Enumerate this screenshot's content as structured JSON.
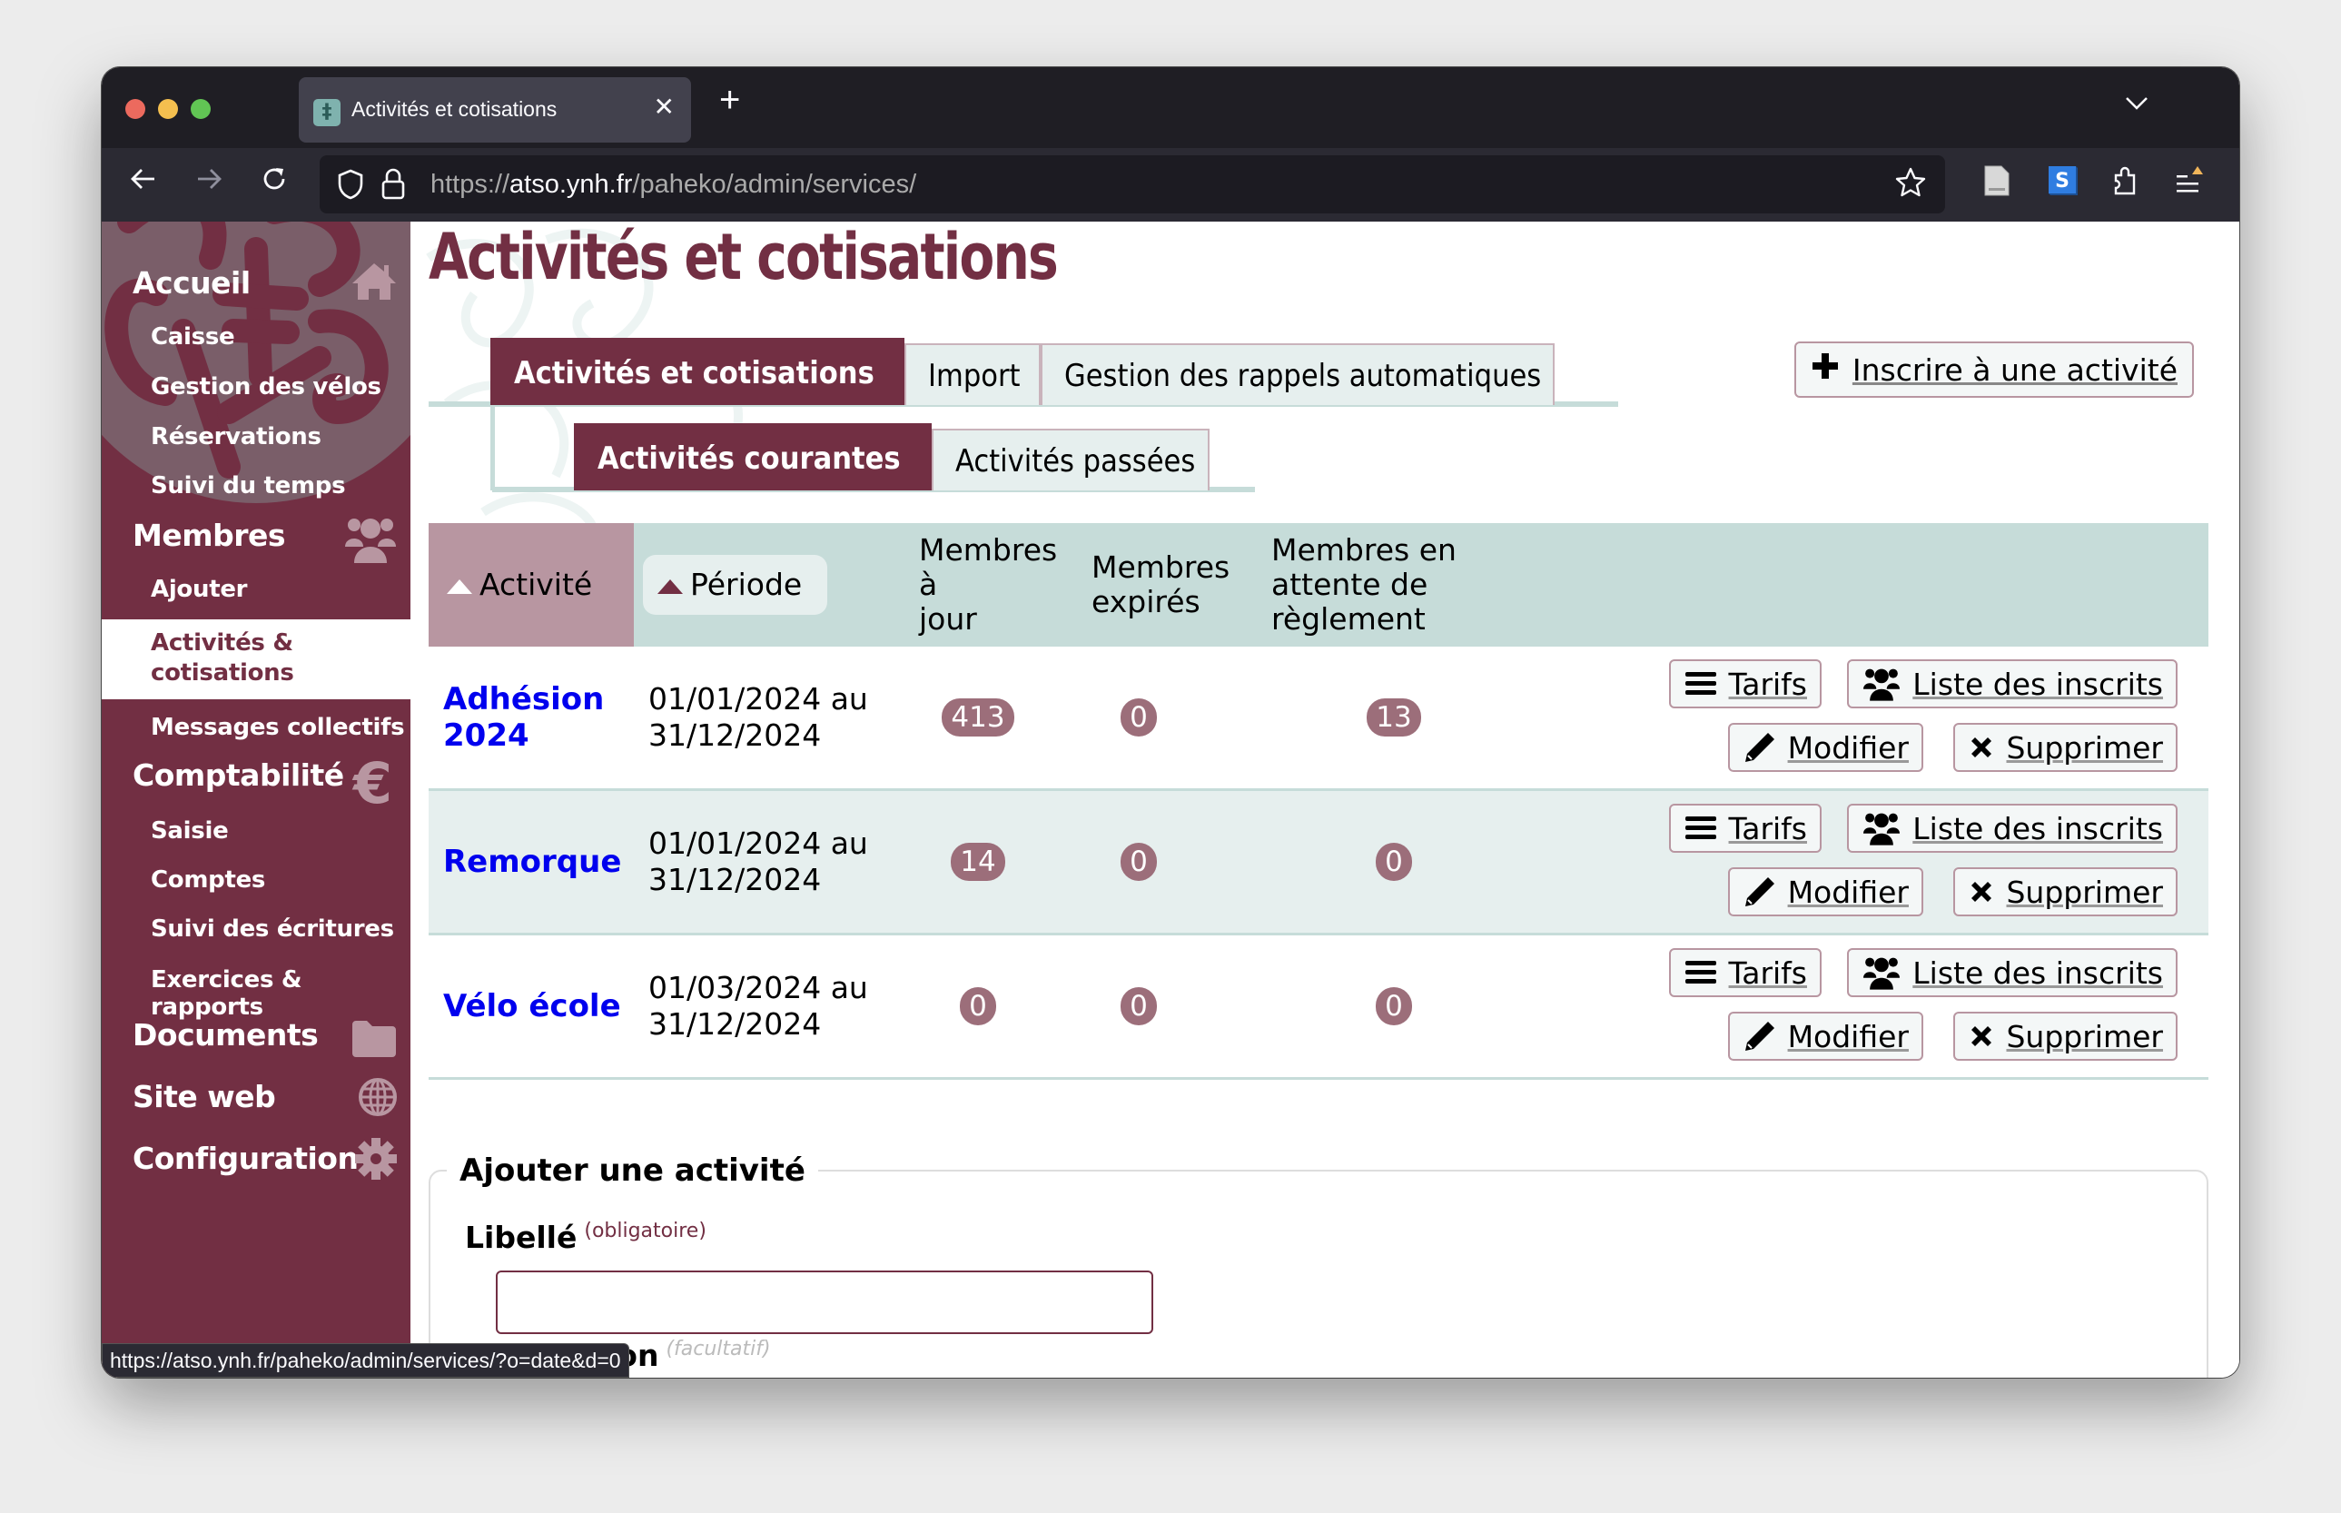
{
  "browser": {
    "tab_title": "Activités et cotisations",
    "url_prefix": "https://",
    "url_host": "atso.ynh.fr",
    "url_path": "/paheko/admin/services/",
    "status_url": "https://atso.ynh.fr/paheko/admin/services/?o=date&d=0",
    "icons": [
      "back-icon",
      "forward-icon",
      "reload-icon",
      "shield-icon",
      "lock-icon",
      "star-icon",
      "reader-icon",
      "extension-s-icon",
      "extensions-icon",
      "menu-icon"
    ]
  },
  "sidebar": {
    "sections": [
      {
        "label": "Accueil",
        "icon": "home-icon",
        "items": [
          "Caisse",
          "Gestion des vélos",
          "Réservations",
          "Suivi du temps"
        ]
      },
      {
        "label": "Membres",
        "icon": "users-icon",
        "items": [
          "Ajouter",
          "Activités & cotisations",
          "Messages collectifs"
        ]
      },
      {
        "label": "Comptabilité",
        "icon": "euro-icon",
        "items": [
          "Saisie",
          "Comptes",
          "Suivi des écritures",
          "Exercices & rapports"
        ]
      },
      {
        "label": "Documents",
        "icon": "folder-icon",
        "items": []
      },
      {
        "label": "Site web",
        "icon": "globe-icon",
        "items": []
      },
      {
        "label": "Configuration",
        "icon": "gear-icon",
        "items": []
      }
    ],
    "active_item": "Activités & cotisations",
    "active_item_line1": "Activités &",
    "active_item_line2": "cotisations"
  },
  "page": {
    "title": "Activités et cotisations",
    "tabs": [
      {
        "label": "Activités et cotisations",
        "active": true
      },
      {
        "label": "Import",
        "active": false
      },
      {
        "label": "Gestion des rappels automatiques",
        "active": false
      }
    ],
    "subtabs": [
      {
        "label": "Activités courantes",
        "active": true
      },
      {
        "label": "Activités passées",
        "active": false
      }
    ],
    "add_button": "Inscrire à une activité"
  },
  "table": {
    "headers": {
      "activity": "Activité",
      "period": "Période",
      "up_to_date_1": "Membres à",
      "up_to_date_2": "jour",
      "expired_1": "Membres",
      "expired_2": "expirés",
      "pending_1": "Membres en",
      "pending_2": "attente de",
      "pending_3": "règlement"
    },
    "rows": [
      {
        "name_1": "Adhésion",
        "name_2": "2024",
        "period_1": "01/01/2024 au",
        "period_2": "31/12/2024",
        "up_to_date": "413",
        "expired": "0",
        "pending": "13"
      },
      {
        "name_1": "Remorque",
        "name_2": "",
        "period_1": "01/01/2024 au",
        "period_2": "31/12/2024",
        "up_to_date": "14",
        "expired": "0",
        "pending": "0"
      },
      {
        "name_1": "Vélo école",
        "name_2": "",
        "period_1": "01/03/2024 au",
        "period_2": "31/12/2024",
        "up_to_date": "0",
        "expired": "0",
        "pending": "0"
      }
    ],
    "row_actions": {
      "tarifs": "Tarifs",
      "inscrits": "Liste des inscrits",
      "modifier": "Modifier",
      "supprimer": "Supprimer"
    }
  },
  "form": {
    "legend": "Ajouter une activité",
    "label_field": "Libellé",
    "label_required": "(obligatoire)",
    "description_field": "Description",
    "description_optional": "(facultatif)",
    "label_value": "",
    "description_value": ""
  },
  "colors": {
    "brand": "#722f43",
    "accent_light": "#c6dcd9",
    "badge": "#9c6e7a",
    "link": "#0000ee"
  }
}
